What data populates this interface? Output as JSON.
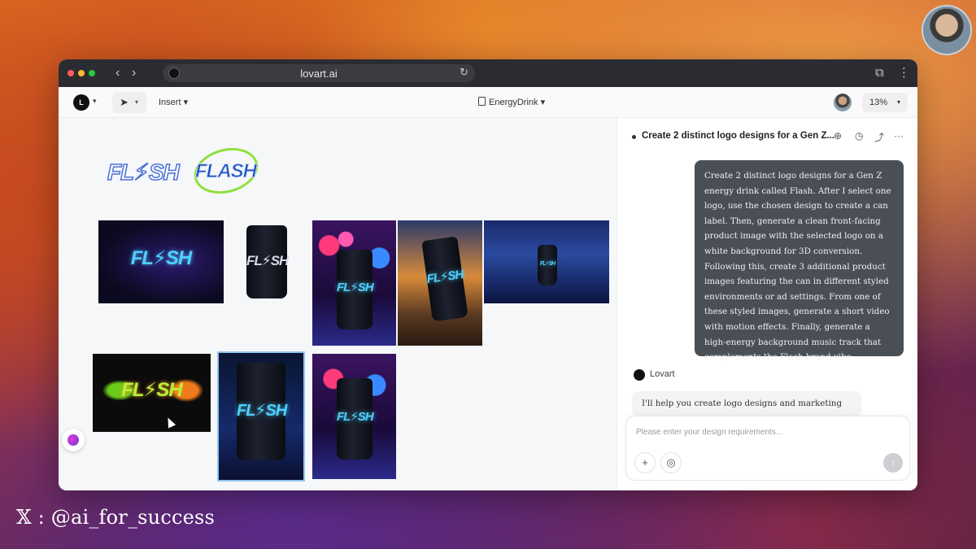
{
  "watermark": "𝕏 : @ai_for_success",
  "browser": {
    "url": "lovart.ai",
    "back_icon": "chevron-left-icon",
    "forward_icon": "chevron-right-icon"
  },
  "toolbar": {
    "insert_label": "Insert",
    "document_name": "EnergyDrink",
    "zoom": "13%"
  },
  "canvas": {
    "logos": [
      {
        "text": "FL⚡SH",
        "style": "chrome-outline"
      },
      {
        "text": "FLASH",
        "style": "green-ring"
      }
    ],
    "tiles": [
      {
        "label": "FL⚡SH"
      },
      {
        "label": "FL⚡SH"
      },
      {
        "label": "FL⚡SH"
      },
      {
        "label": "FL⚡SH"
      },
      {
        "label": "FL⚡SH"
      },
      {
        "label": "FL⚡SH"
      },
      {
        "label": "FL⚡SH"
      },
      {
        "label": "FL⚡SH"
      }
    ]
  },
  "chat": {
    "title": "Create 2 distinct logo designs for a Gen Z...",
    "user_message": "Create 2 distinct logo designs for a Gen Z energy drink called Flash. After I select one logo, use the chosen design to create a can label. Then, generate a clean front-facing product image with the selected logo on a white background for 3D conversion. Following this, create 3 additional product images featuring the can in different styled environments or ad settings. From one of these styled images, generate a short video with motion effects. Finally, generate a high-energy background music track that complements the Flash brand vibe",
    "assistant_name": "Lovart",
    "assistant_reply": "I'll help you create logo designs and marketing",
    "input_placeholder": "Please enter your design requirements..."
  }
}
